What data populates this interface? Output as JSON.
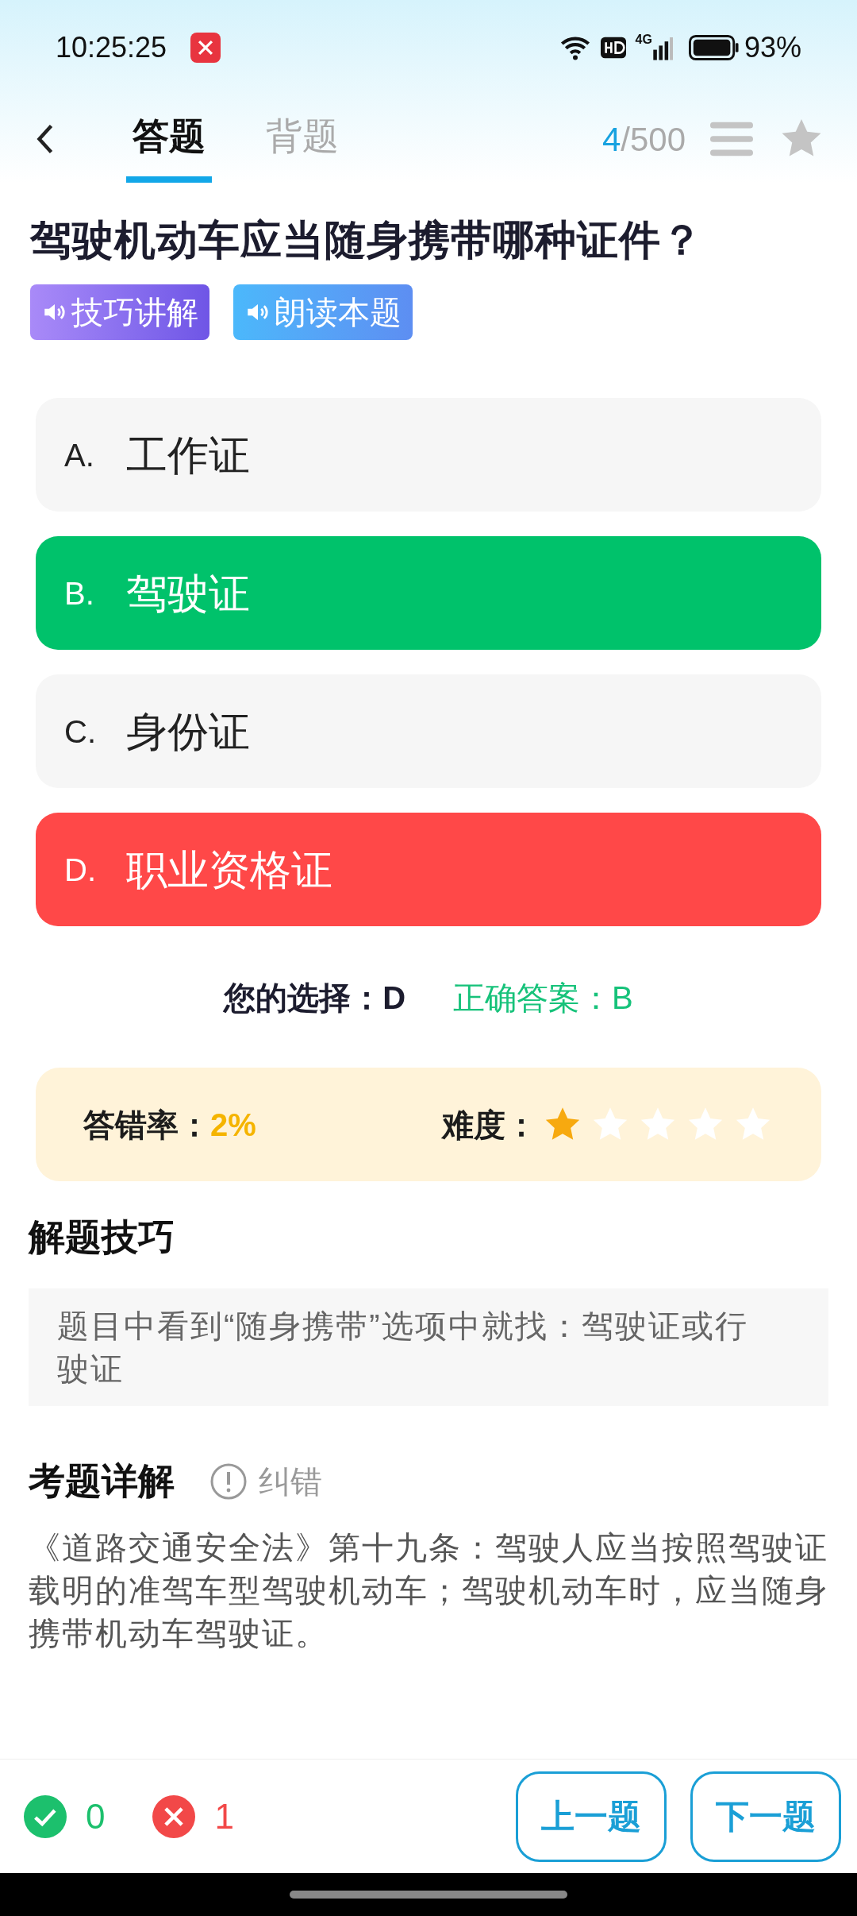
{
  "status_bar": {
    "time": "10:25:25",
    "battery": "93%",
    "network": "4G"
  },
  "header": {
    "tabs": [
      {
        "label": "答题",
        "selected": true
      },
      {
        "label": "背题",
        "selected": false
      }
    ],
    "progress_current": "4",
    "progress_total": "/500",
    "favorited": false
  },
  "question": {
    "text": "驾驶机动车应当随身携带哪种证件？",
    "audio_buttons": [
      "技巧讲解",
      "朗读本题"
    ]
  },
  "options": [
    {
      "letter": "A.",
      "text": "工作证",
      "kind": "plain"
    },
    {
      "letter": "B.",
      "text": "驾驶证",
      "kind": "correct"
    },
    {
      "letter": "C.",
      "text": "身份证",
      "kind": "plain"
    },
    {
      "letter": "D.",
      "text": "职业资格证",
      "kind": "wrong"
    }
  ],
  "answer": {
    "your_label": "您的选择：",
    "your_value": "D",
    "correct_label": "正确答案：",
    "correct_value": "B"
  },
  "stats": {
    "error_label": "答错率：",
    "error_value": "2%",
    "difficulty_label": "难度：",
    "stars": 1
  },
  "tips": {
    "title": "解题技巧",
    "text": "题目中看到“随身携带”选项中就找：驾驶证或行驶证"
  },
  "explanation": {
    "title": "考题详解",
    "report": "纠错",
    "text": "《道路交通安全法》第十九条：驾驶人应当按照驾驶证载明的准驾车型驾驶机动车；驾驶机动车时，应当随身携带机动车驾驶证。"
  },
  "footer": {
    "correct_count": "0",
    "wrong_count": "1",
    "buttons": [
      "上一题",
      "下一题"
    ]
  }
}
